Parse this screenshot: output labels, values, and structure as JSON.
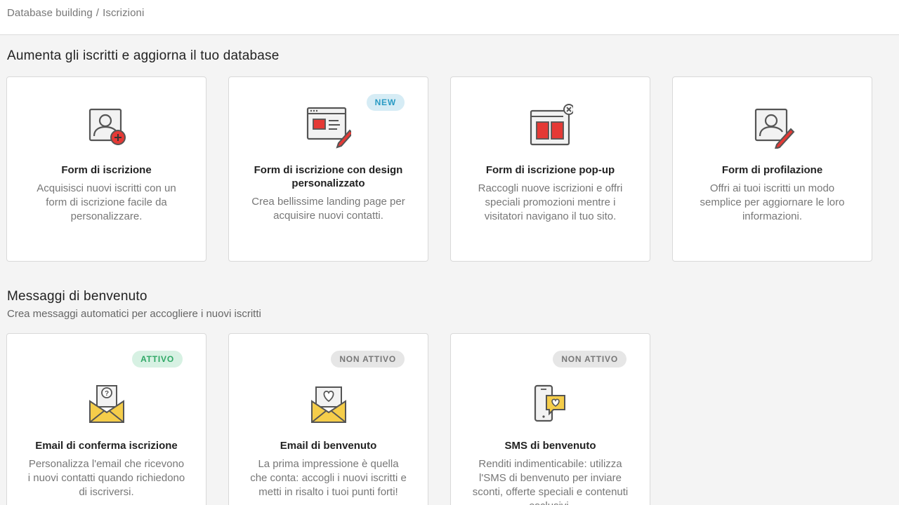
{
  "breadcrumb": {
    "parent": "Database building",
    "separator": "/",
    "current": "Iscrizioni"
  },
  "section1": {
    "title": "Aumenta gli iscritti e aggiorna il tuo database",
    "cards": [
      {
        "icon": "user-add-icon",
        "title": "Form di iscrizione",
        "description": "Acquisisci nuovi iscritti con un form di iscrizione facile da personalizzare."
      },
      {
        "icon": "landing-page-design-icon",
        "badge": "NEW",
        "title": "Form di iscrizione con design personalizzato",
        "description": "Crea bellissime landing page per acquisire nuovi contatti."
      },
      {
        "icon": "popup-window-icon",
        "title": "Form di iscrizione pop-up",
        "description": "Raccogli nuove iscrizioni e offri speciali promozioni mentre i visitatori navigano il tuo sito."
      },
      {
        "icon": "user-edit-icon",
        "title": "Form di profilazione",
        "description": "Offri ai tuoi iscritti un modo semplice per aggiornare le loro informazioni."
      }
    ]
  },
  "section2": {
    "title": "Messaggi di benvenuto",
    "subtitle": "Crea messaggi automatici per accogliere i nuovi iscritti",
    "cards": [
      {
        "icon": "envelope-question-icon",
        "badge": "ATTIVO",
        "title": "Email di conferma iscrizione",
        "description": "Personalizza l'email che ricevono i nuovi contatti quando richiedono di iscriversi."
      },
      {
        "icon": "envelope-heart-icon",
        "badge": "NON ATTIVO",
        "title": "Email di benvenuto",
        "description": "La prima impressione è quella che conta: accogli i nuovi iscritti e metti in risalto i tuoi punti forti!"
      },
      {
        "icon": "phone-sms-heart-icon",
        "badge": "NON ATTIVO",
        "title": "SMS di benvenuto",
        "description": "Renditi indimenticabile: utilizza l'SMS di benvenuto per inviare sconti, offerte speciali e contenuti esclusivi."
      }
    ]
  },
  "colors": {
    "accent_red": "#e53935",
    "envelope_yellow": "#f5cd4a",
    "icon_gray": "#555555",
    "badge_new": "#2a9bc4",
    "badge_active": "#2fa866",
    "badge_inactive": "#777777"
  }
}
